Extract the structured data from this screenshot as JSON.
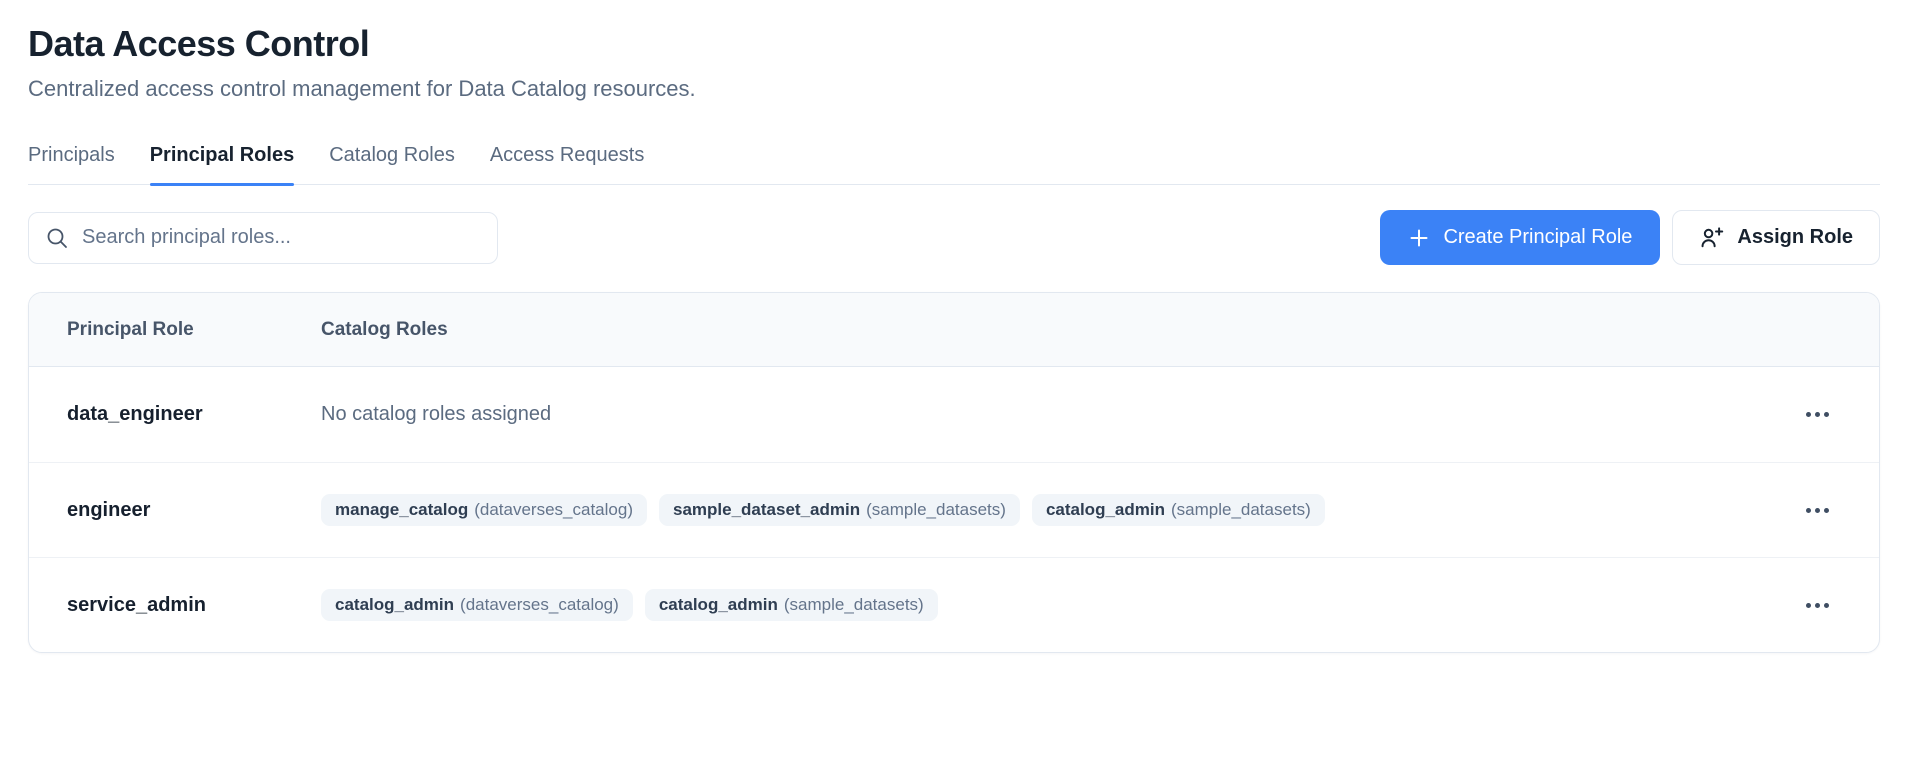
{
  "page": {
    "title": "Data Access Control",
    "subtitle": "Centralized access control management for Data Catalog resources."
  },
  "tabs": [
    {
      "label": "Principals",
      "active": false
    },
    {
      "label": "Principal Roles",
      "active": true
    },
    {
      "label": "Catalog Roles",
      "active": false
    },
    {
      "label": "Access Requests",
      "active": false
    }
  ],
  "toolbar": {
    "search_placeholder": "Search principal roles...",
    "search_icon": "magnifier",
    "create_button_label": "Create Principal Role",
    "create_button_icon": "plus",
    "assign_button_label": "Assign Role",
    "assign_button_icon": "user-plus"
  },
  "table": {
    "columns": [
      "Principal Role",
      "Catalog Roles"
    ],
    "row_menu_icon": "ellipsis",
    "rows": [
      {
        "principal_role": "data_engineer",
        "empty_text": "No catalog roles assigned",
        "catalog_roles": []
      },
      {
        "principal_role": "engineer",
        "empty_text": "",
        "catalog_roles": [
          {
            "role": "manage_catalog",
            "catalog": "dataverses_catalog"
          },
          {
            "role": "sample_dataset_admin",
            "catalog": "sample_datasets"
          },
          {
            "role": "catalog_admin",
            "catalog": "sample_datasets"
          }
        ]
      },
      {
        "principal_role": "service_admin",
        "empty_text": "",
        "catalog_roles": [
          {
            "role": "catalog_admin",
            "catalog": "dataverses_catalog"
          },
          {
            "role": "catalog_admin",
            "catalog": "sample_datasets"
          }
        ]
      }
    ]
  },
  "colors": {
    "accent_blue": "#3b82f6",
    "dark_text": "#17222f",
    "gray_text": "#5b6b80",
    "border": "#e2e8f0",
    "table_header_bg": "#f8fafc",
    "badge_bg": "#f1f5f9"
  }
}
